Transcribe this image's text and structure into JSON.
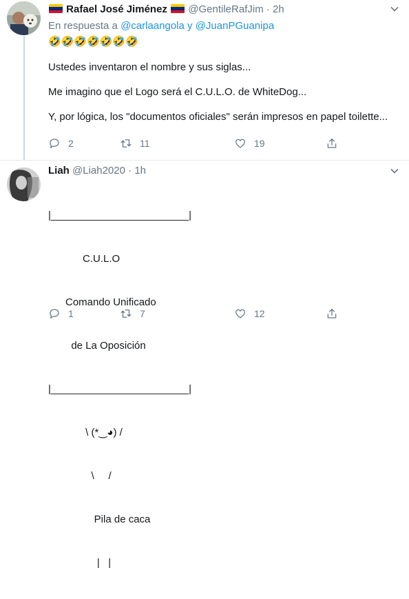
{
  "colors": {
    "link": "#1b95e0",
    "secondary": "#657786",
    "text": "#14171a",
    "divider": "#e6ecf0"
  },
  "tweets": [
    {
      "name": "Rafael José Jiménez",
      "handle": "@GentileRafJim",
      "separator": "·",
      "time": "2h",
      "reply_prefix": "En respuesta a",
      "reply_mentions": "@carlaangola y @JuanPGuanipa",
      "emojis": "🤣🤣🤣🤣🤣🤣🤣",
      "paragraphs": [
        "Ustedes inventaron el nombre y sus siglas...",
        "Me imagino que el Logo será el C.U.L.O. de WhiteDog...",
        "Y, por lógica, los \"documentos oficiales\" serán impresos en papel toilette..."
      ],
      "stats": {
        "replies": "2",
        "retweets": "11",
        "likes": "19"
      },
      "icons": [
        "reply-icon",
        "retweet-icon",
        "like-icon",
        "share-icon",
        "caret-down-icon"
      ]
    },
    {
      "name": "Liah",
      "handle": "@Liah2020",
      "separator": "·",
      "time": "1h",
      "ascii_lines": [
        "|________________________|",
        "            C.U.L.O",
        "      Comando Unificado",
        "        de La Oposición",
        "|________________________|",
        "             \\ (*‿◕) /",
        "               \\     /",
        "                Pila de caca",
        "                 |   |"
      ],
      "stats": {
        "replies": "1",
        "retweets": "7",
        "likes": "12"
      },
      "icons": [
        "reply-icon",
        "retweet-icon",
        "like-icon",
        "share-icon",
        "caret-down-icon"
      ]
    }
  ]
}
